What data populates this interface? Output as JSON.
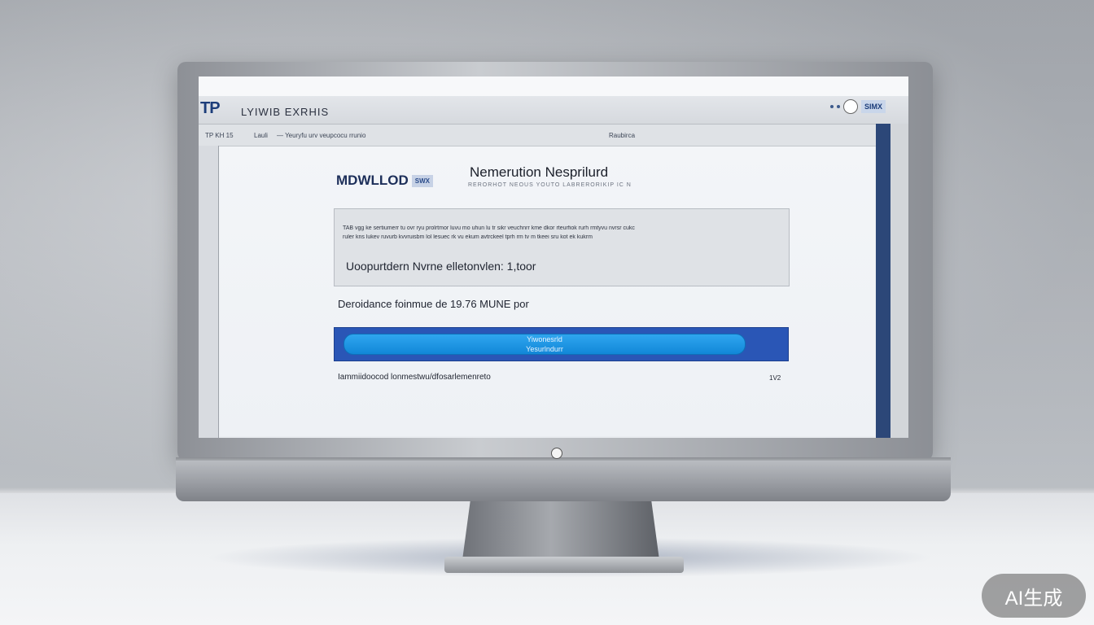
{
  "header": {
    "logo": "TP",
    "title": "LYIWIB EXRHIS",
    "badge": "SIMX"
  },
  "nav": {
    "items": [
      "TP KH 15",
      "Lauli",
      "— Yeuryfu urv veupcocu rrunio",
      "Raubirca"
    ]
  },
  "main": {
    "brand": "MDWLLOD",
    "brand_tag": "SWX",
    "heading": "Nemerution Nesprilurd",
    "subheading": "RERORHOT NEOUS YOUTO LABRERORIKIP IC N",
    "info_line_1": "TAB vgg ke sertiumerr tu ovr ryu prolrtmor luvu mo uhun lu tr sikr veuchnrr kme dkor rteurfiok rurh rmtyvu nvrsr cukc",
    "info_line_2": "ruler kns lukev ruvurb kvvruisbm lol lesuec rk vu ekum avtrckeel tprh rm tv m tkeei sru kot ek kukrm",
    "info_main": "Uoopurtdern Nvrne elletonvlen: 1,toor",
    "file_info": "Deroidance foinmue de 19.76 MUNE por",
    "download_label": "Yiwonesrld",
    "download_sublabel": "Yesurlndurr",
    "footer_text": "Iammiidoocod lonmestwu/dfosarlemenreto",
    "footer_right": "1V2"
  },
  "watermark": "AI生成"
}
